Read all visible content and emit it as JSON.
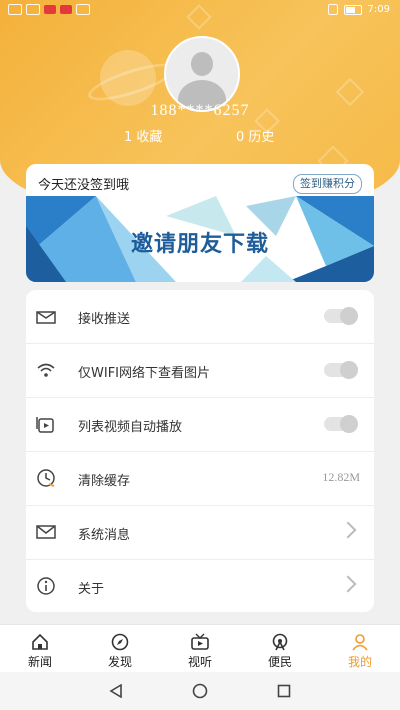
{
  "status_bar": {
    "time": "7:09"
  },
  "profile": {
    "phone": "188****6257",
    "favorites_count": "1 收藏",
    "history_count": "0 历史"
  },
  "signin": {
    "text": "今天还没签到哦",
    "button": "签到赚积分"
  },
  "banner": {
    "text": "邀请朋友下载"
  },
  "settings": {
    "push": "接收推送",
    "wifi_images": "仅WIFI网络下查看图片",
    "autoplay": "列表视频自动播放",
    "clear_cache": "清除缓存",
    "cache_size": "12.82M",
    "messages": "系统消息",
    "about": "关于"
  },
  "tabs": [
    {
      "label": "新闻",
      "icon": "home-icon"
    },
    {
      "label": "发现",
      "icon": "compass-icon"
    },
    {
      "label": "视听",
      "icon": "video-icon"
    },
    {
      "label": "便民",
      "icon": "service-icon"
    },
    {
      "label": "我的",
      "icon": "person-icon"
    }
  ],
  "colors": {
    "header": "#f4b13a",
    "active_tab": "#f19b28",
    "banner_text": "#1e5d9a"
  }
}
